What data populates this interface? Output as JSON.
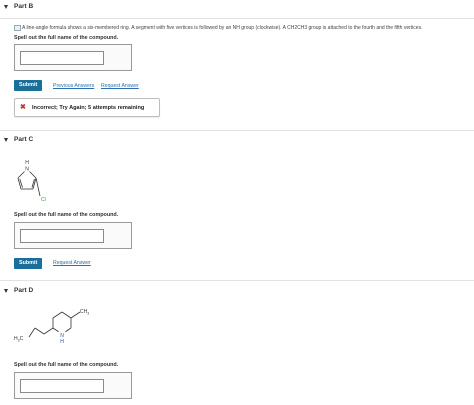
{
  "partB": {
    "title": "Part B",
    "image_alt": "A line-angle formula shows a six-membered ring. A segment with five vertices is followed by an NH group (clockwise). A CH2CH3 group is attached to the fourth and the fifth vertices.",
    "prompt": "Spell out the full name of the compound.",
    "answer_value": "",
    "submit_label": "Submit",
    "previous_answers_label": "Previous Answers",
    "request_answer_label": "Request Answer",
    "feedback_icon": "x-mark-icon",
    "feedback_text": "Incorrect; Try Again; 5 attempts remaining",
    "feedback_color": "#c0392b"
  },
  "partC": {
    "title": "Part C",
    "structure_labels": {
      "h": "H",
      "n": "N",
      "cl": "Cl"
    },
    "prompt": "Spell out the full name of the compound.",
    "answer_value": "",
    "submit_label": "Submit",
    "request_answer_label": "Request Answer"
  },
  "partD": {
    "title": "Part D",
    "structure_labels": {
      "ch3": "CH",
      "ch3_sub": "3",
      "h3c": "H",
      "h3c_sub": "3",
      "h3c_tail": "C",
      "n": "N",
      "h": "H"
    },
    "prompt": "Spell out the full name of the compound.",
    "answer_value": ""
  },
  "colors": {
    "accent": "#1a6f9a",
    "link": "#2a6fb0",
    "error": "#c0392b"
  }
}
